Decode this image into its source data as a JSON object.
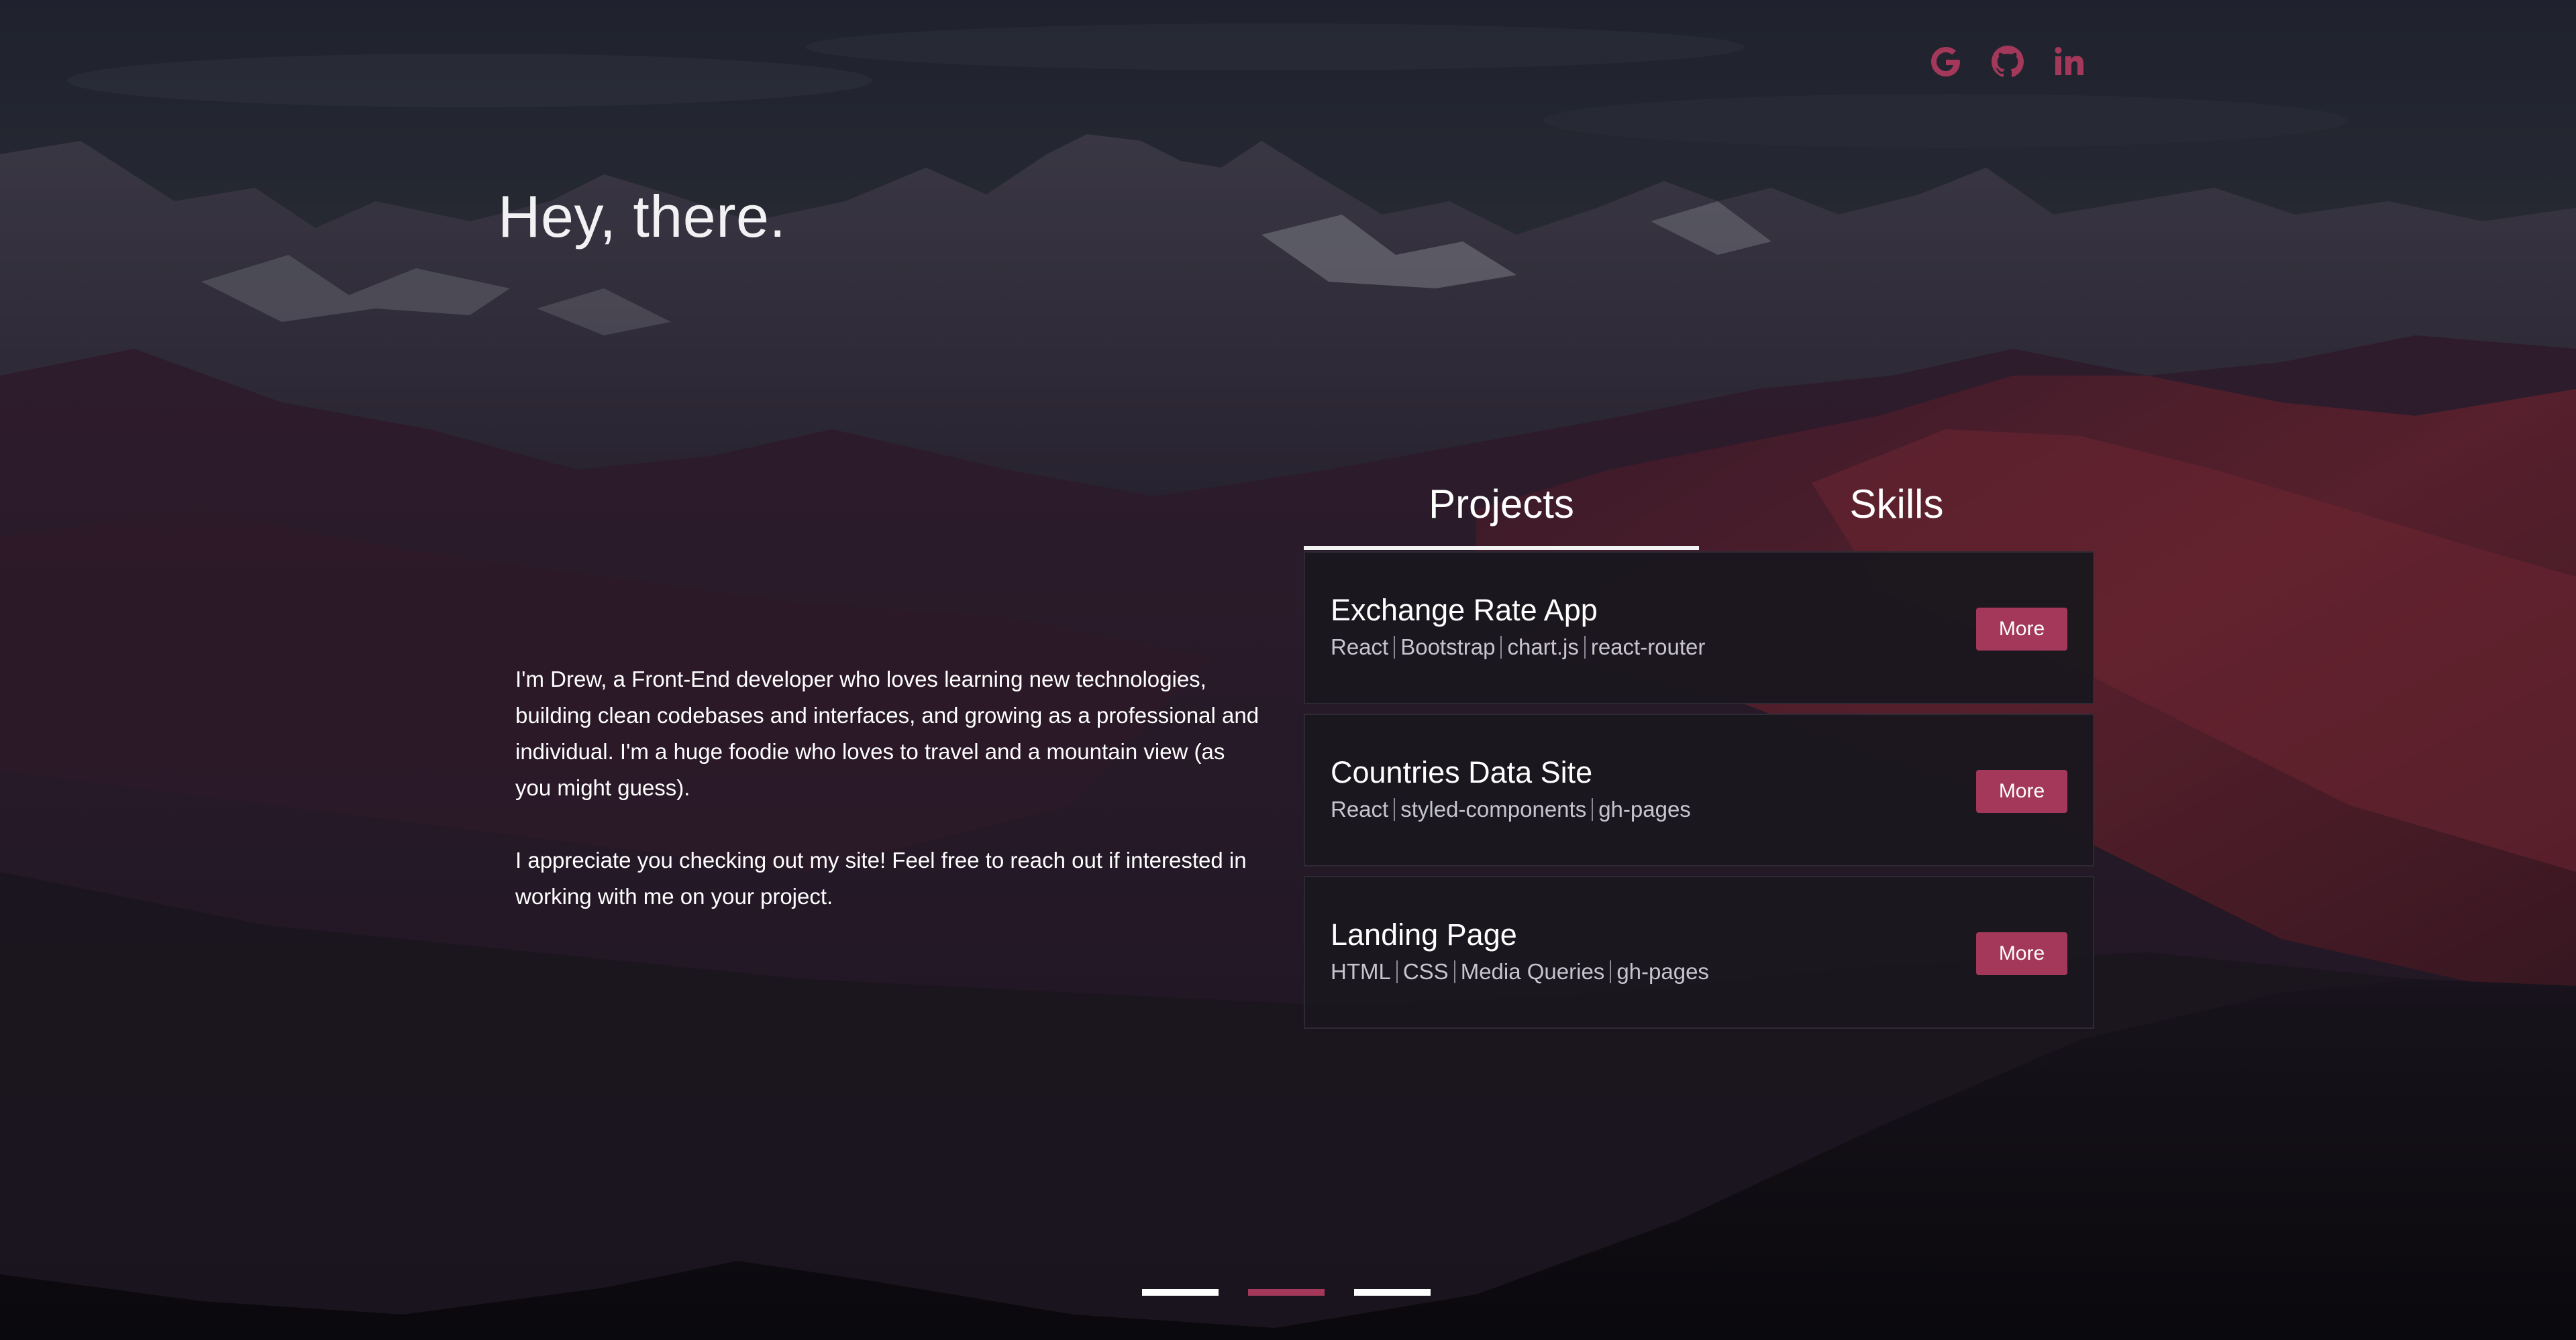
{
  "header": {
    "social_icons": [
      "google-icon",
      "github-icon",
      "linkedin-icon"
    ],
    "icon_color": "#a3385a"
  },
  "hero": {
    "greeting": "Hey, there."
  },
  "about": {
    "paragraph_1": "I'm Drew, a Front-End developer who loves learning new technologies, building clean codebases and interfaces, and growing as a professional and individual. I'm a huge foodie who loves to travel and a mountain view (as you might guess).",
    "paragraph_2": "I appreciate you checking out my site! Feel free to reach out if interested in working with me on your project."
  },
  "tabs": [
    {
      "label": "Projects",
      "active": true
    },
    {
      "label": "Skills",
      "active": false
    }
  ],
  "projects": [
    {
      "title": "Exchange Rate App",
      "tags": [
        "React",
        "Bootstrap",
        "chart.js",
        "react-router"
      ],
      "button_label": "More"
    },
    {
      "title": "Countries Data Site",
      "tags": [
        "React",
        "styled-components",
        "gh-pages"
      ],
      "button_label": "More"
    },
    {
      "title": "Landing Page",
      "tags": [
        "HTML",
        "CSS",
        "Media Queries",
        "gh-pages"
      ],
      "button_label": "More"
    }
  ],
  "pagination": {
    "count": 3,
    "active_index": 1
  },
  "colors": {
    "accent": "#a3385a",
    "card_bg": "#1a171e"
  }
}
